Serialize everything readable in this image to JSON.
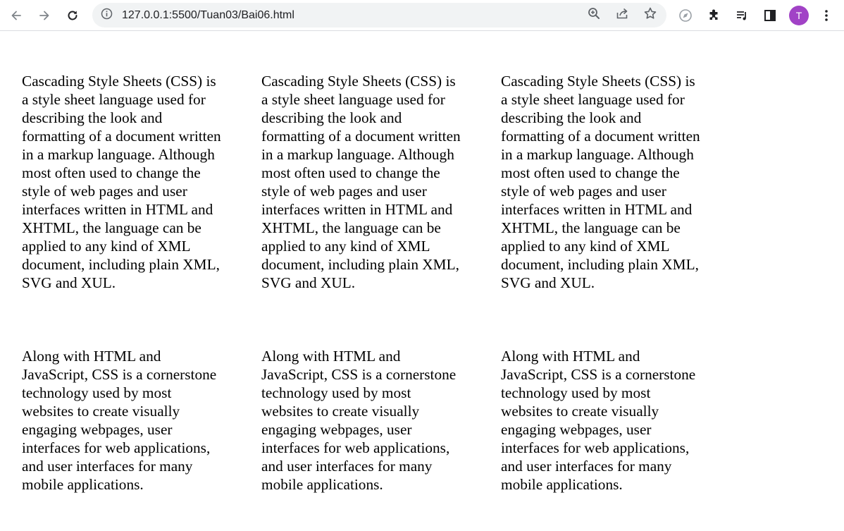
{
  "browser": {
    "url": "127.0.0.1:5500/Tuan03/Bai06.html",
    "profile_initial": "T",
    "profile_color": "#a142c6",
    "icons": {
      "back": "arrow-left-icon",
      "forward": "arrow-right-icon",
      "reload": "reload-icon",
      "site_info": "info-icon",
      "zoom": "zoom-in-icon",
      "share": "share-icon",
      "bookmark": "star-icon",
      "extension_compass": "compass-icon",
      "extensions": "puzzle-icon",
      "reading_list": "reading-list-icon",
      "side_panel": "side-panel-icon",
      "menu": "more-vertical-icon"
    }
  },
  "page": {
    "rows": [
      {
        "columns": [
          "Cascading Style Sheets (CSS) is a style sheet language used for describing the look and formatting of a document written in a markup language. Although most often used to change the style of web pages and user interfaces written in HTML and XHTML, the language can be applied to any kind of XML document, including plain XML, SVG and XUL.",
          "Cascading Style Sheets (CSS) is a style sheet language used for describing the look and formatting of a document written in a markup language. Although most often used to change the style of web pages and user interfaces written in HTML and XHTML, the language can be applied to any kind of XML document, including plain XML, SVG and XUL.",
          "Cascading Style Sheets (CSS) is a style sheet language used for describing the look and formatting of a document written in a markup language. Although most often used to change the style of web pages and user interfaces written in HTML and XHTML, the language can be applied to any kind of XML document, including plain XML, SVG and XUL."
        ]
      },
      {
        "columns": [
          "Along with HTML and JavaScript, CSS is a cornerstone technology used by most websites to create visually engaging webpages, user interfaces for web applications, and user interfaces for many mobile applications.",
          "Along with HTML and JavaScript, CSS is a cornerstone technology used by most websites to create visually engaging webpages, user interfaces for web applications, and user interfaces for many mobile applications.",
          "Along with HTML and JavaScript, CSS is a cornerstone technology used by most websites to create visually engaging webpages, user interfaces for web applications, and user interfaces for many mobile applications."
        ]
      }
    ]
  }
}
